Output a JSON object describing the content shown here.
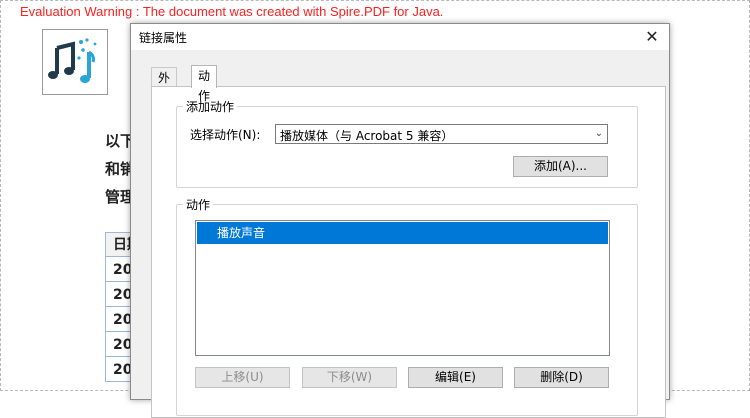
{
  "background": {
    "eval_warning": "Evaluation Warning : The document was created with Spire.PDF for Java.",
    "text_lines": [
      "以下",
      "和销",
      "管理"
    ],
    "table_cells": [
      "日期",
      "20",
      "20",
      "20",
      "20",
      "20"
    ]
  },
  "dialog": {
    "title": "链接属性",
    "close_icon": "close-icon",
    "tabs": [
      {
        "label": "外观",
        "active": false
      },
      {
        "label": "动作",
        "active": true
      }
    ],
    "add_action": {
      "group_label": "添加动作",
      "select_label": "选择动作(N):",
      "select_value": "播放媒体（与 Acrobat 5 兼容）",
      "add_button": "添加(A)..."
    },
    "actions": {
      "group_label": "动作",
      "items": [
        "播放声音"
      ],
      "selected_index": 0,
      "buttons": {
        "up": "上移(U)",
        "down": "下移(W)",
        "edit": "编辑(E)",
        "delete": "删除(D)"
      }
    }
  },
  "colors": {
    "warning": "#ff2020",
    "selection": "#0078d7",
    "logo_dark": "#1f3a4d",
    "logo_accent": "#2aa6d6"
  }
}
